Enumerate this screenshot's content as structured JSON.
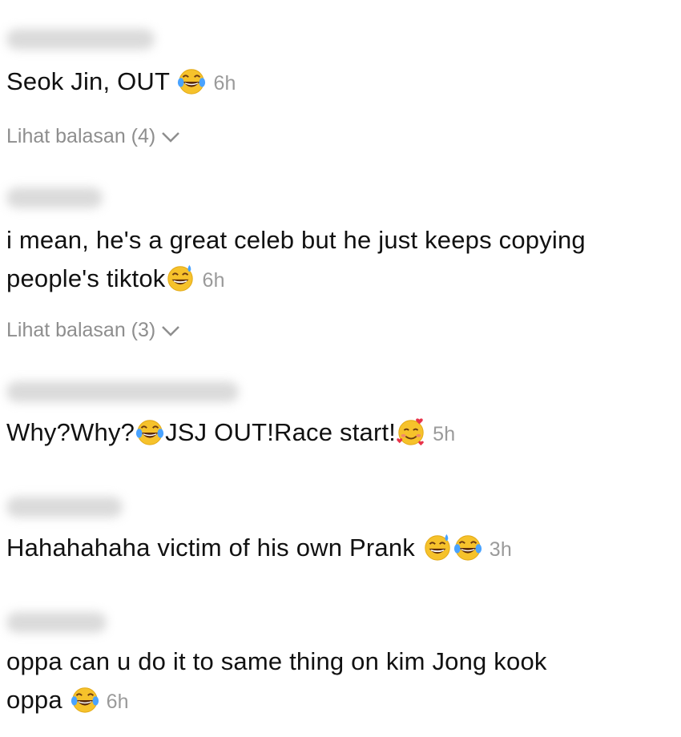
{
  "comments": [
    {
      "text": "Seok Jin, OUT",
      "emojis_after": [
        "laugh-tears-emoji"
      ],
      "time": "6h",
      "replies_label": "Lihat balasan (4)"
    },
    {
      "text_line1": "i mean, he's a great celeb but he just keeps copying",
      "text_line2": "people's tiktok",
      "emojis_after": [
        "sweat-smile-emoji"
      ],
      "time": "6h",
      "replies_label": "Lihat balasan (3)"
    },
    {
      "text_a": "Why?Why?",
      "text_b": "JSJ OUT!Race start!",
      "emojis": [
        "laugh-tears-emoji",
        "smiling-hearts-emoji"
      ],
      "time": "5h"
    },
    {
      "text": "Hahahahaha victim of his own Prank ",
      "emojis_after": [
        "sweat-smile-emoji",
        "laugh-tears-emoji"
      ],
      "time": "3h"
    },
    {
      "text_line1": "oppa can u do it to same thing on kim Jong kook",
      "text_line2": "oppa ",
      "emojis_after": [
        "laugh-tears-emoji"
      ],
      "time": "6h"
    }
  ],
  "colors": {
    "text": "#111111",
    "muted": "#8e8e8e",
    "emoji_yellow": "#f6c22b"
  }
}
